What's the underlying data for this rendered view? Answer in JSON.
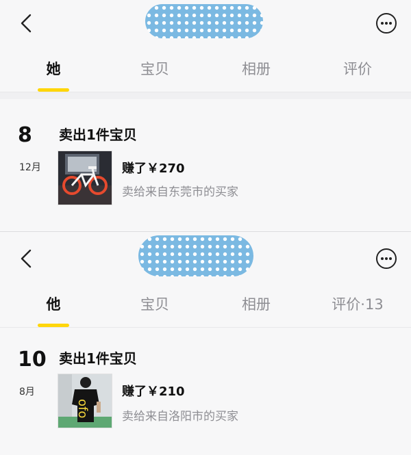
{
  "panel1": {
    "tabs": [
      "她",
      "宝贝",
      "相册",
      "评价"
    ],
    "active_tab": 0,
    "record": {
      "day": "8",
      "month": "12月",
      "title": "卖出1件宝贝",
      "earned": "赚了￥270",
      "buyer": "卖给来自东莞市的买家"
    }
  },
  "panel2": {
    "tabs": [
      "他",
      "宝贝",
      "相册",
      "评价·13"
    ],
    "active_tab": 0,
    "record": {
      "day": "10",
      "month": "8月",
      "title": "卖出1件宝贝",
      "earned": "赚了￥210",
      "buyer": "卖给来自洛阳市的买家"
    }
  },
  "icons": {
    "back": "chevron-left-icon",
    "more": "more-dots-icon"
  },
  "colors": {
    "accent": "#ffd60a",
    "blob": "#7bb9e2"
  }
}
